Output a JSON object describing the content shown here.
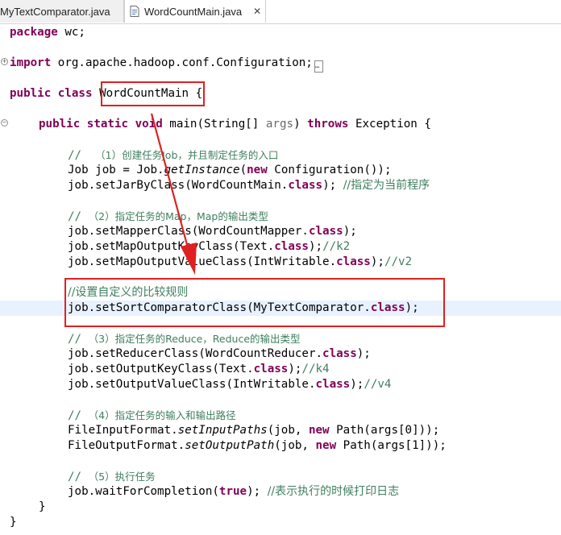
{
  "tabs": [
    {
      "label": "MyTextComparator.java",
      "active": false
    },
    {
      "label": "WordCountMain.java",
      "active": true,
      "close": "✕"
    }
  ],
  "code": {
    "l1_kw": "package",
    "l1_rest": " wc;",
    "l2_kw": "import",
    "l2_rest": " org.apache.hadoop.conf.Configuration;",
    "l3_kw1": "public",
    "l3_kw2": "class",
    "l3_name": "WordCountMain",
    "l3_brace": " {",
    "l4_kw1": "public",
    "l4_kw2": "static",
    "l4_kw3": "void",
    "l4_a": " main(String[] ",
    "l4_args": "args",
    "l4_b": ") ",
    "l4_throws": "throws",
    "l4_c": " Exception {",
    "c1_slash": "//  ",
    "c1_text": "（1）创建任务Job，并且制定任务的入口",
    "l5_a": "Job job = Job.",
    "l5_method": "getInstance",
    "l5_b": "(",
    "l5_new": "new",
    "l5_c": " Configuration());",
    "l6_a": "job.setJarByClass(WordCountMain.",
    "l6_class": "class",
    "l6_b": "); ",
    "l6_comment": "//指定为当前程序",
    "c2_slash": "// ",
    "c2_text": "（2）指定任务的Map，Map的输出类型",
    "l7_a": "job.setMapperClass(WordCountMapper.",
    "l7_class": "class",
    "l7_b": ");",
    "l8_a": "job.setMapOutputKeyClass(Text.",
    "l8_class": "class",
    "l8_b": ");",
    "l8_comment": "//k2",
    "l9_a": "job.setMapOutputValueClass(IntWritable.",
    "l9_class": "class",
    "l9_b": ");",
    "l9_comment": "//v2",
    "c3_text": "//设置自定义的比较规则",
    "l10_a": "job.setSortComparatorClass(MyTextComparator.",
    "l10_class": "class",
    "l10_b": ");",
    "c4_slash": "// ",
    "c4_text": "（3）指定任务的Reduce，Reduce的输出类型",
    "l11_a": "job.setReducerClass(WordCountReducer.",
    "l11_class": "class",
    "l11_b": ");",
    "l12_a": "job.setOutputKeyClass(Text.",
    "l12_class": "class",
    "l12_b": ");",
    "l12_comment": "//k4",
    "l13_a": "job.setOutputValueClass(IntWritable.",
    "l13_class": "class",
    "l13_b": ");",
    "l13_comment": "//v4",
    "c5_slash": "// ",
    "c5_text": "（4）指定任务的输入和输出路径",
    "l14_a": "FileInputFormat.",
    "l14_method": "setInputPaths",
    "l14_b": "(job, ",
    "l14_new": "new",
    "l14_c": " Path(args[0]));",
    "l15_a": "FileOutputFormat.",
    "l15_method": "setOutputPath",
    "l15_b": "(job, ",
    "l15_new": "new",
    "l15_c": " Path(args[1]));",
    "c6_slash": "// ",
    "c6_text": "（5）执行任务",
    "l16_a": "job.waitForCompletion(",
    "l16_true": "true",
    "l16_b": "); ",
    "l16_comment": "//表示执行的时候打印日志",
    "l17": "}",
    "l18": "}"
  },
  "colors": {
    "keyword": "#7f0055",
    "comment": "#3f7f5f",
    "highlight": "#e02020",
    "current_line": "#e8f2fe"
  }
}
